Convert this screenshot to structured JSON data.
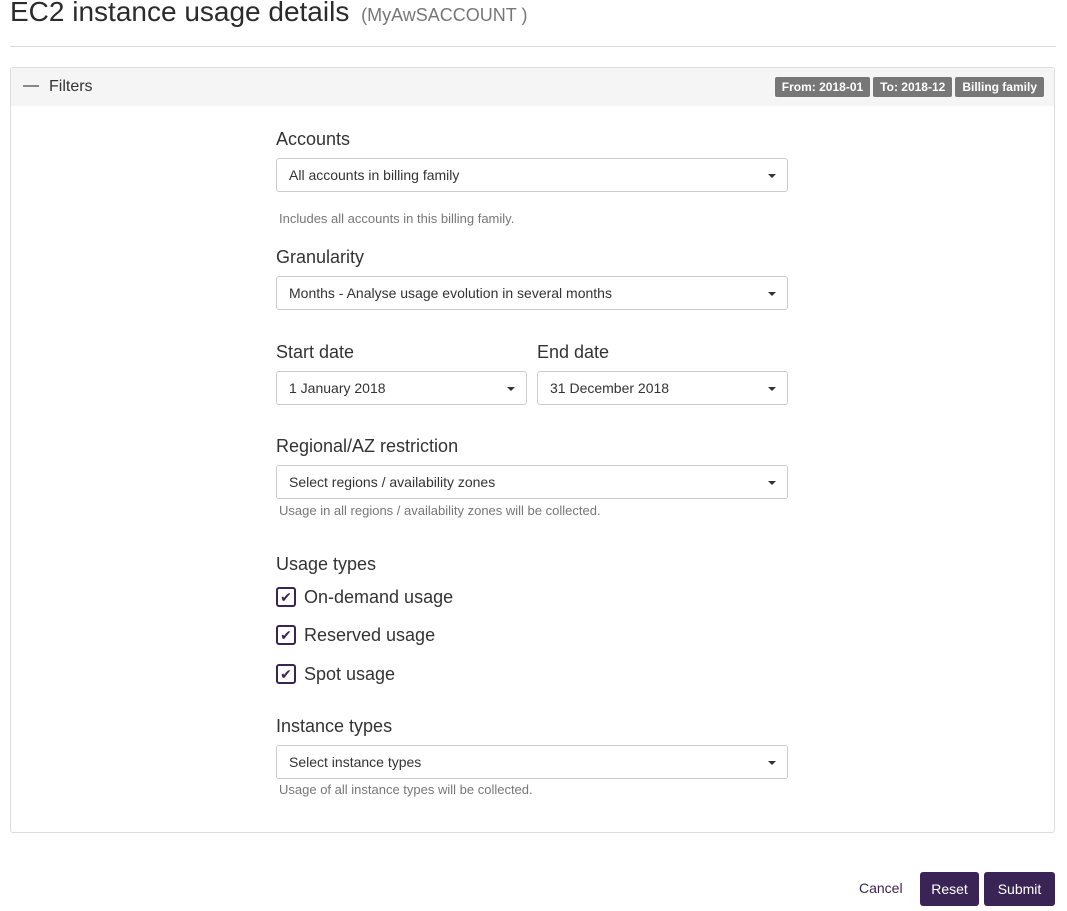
{
  "page": {
    "title": "EC2 instance usage details",
    "subtitle": "(MyAwSACCOUNT )"
  },
  "filters": {
    "title": "Filters",
    "badges": [
      "From: 2018-01",
      "To: 2018-12",
      "Billing family"
    ]
  },
  "accounts": {
    "label": "Accounts",
    "value": "All accounts in billing family",
    "help": "Includes all accounts in this billing family."
  },
  "granularity": {
    "label": "Granularity",
    "value": "Months - Analyse usage evolution in several months"
  },
  "start_date": {
    "label": "Start date",
    "value": "1 January 2018"
  },
  "end_date": {
    "label": "End date",
    "value": "31 December 2018"
  },
  "region": {
    "label": "Regional/AZ restriction",
    "placeholder": "Select regions / availability zones",
    "help": "Usage in all regions / availability zones will be collected."
  },
  "usage_types": {
    "label": "Usage types",
    "items": [
      {
        "label": "On-demand usage",
        "checked": true
      },
      {
        "label": "Reserved usage",
        "checked": true
      },
      {
        "label": "Spot usage",
        "checked": true
      }
    ]
  },
  "instance_types": {
    "label": "Instance types",
    "placeholder": "Select instance types",
    "help": "Usage of all instance types will be collected."
  },
  "actions": {
    "cancel": "Cancel",
    "reset": "Reset",
    "submit": "Submit"
  },
  "colors": {
    "primary": "#3a2456",
    "badge": "#777777",
    "panel_heading": "#f5f5f5"
  }
}
